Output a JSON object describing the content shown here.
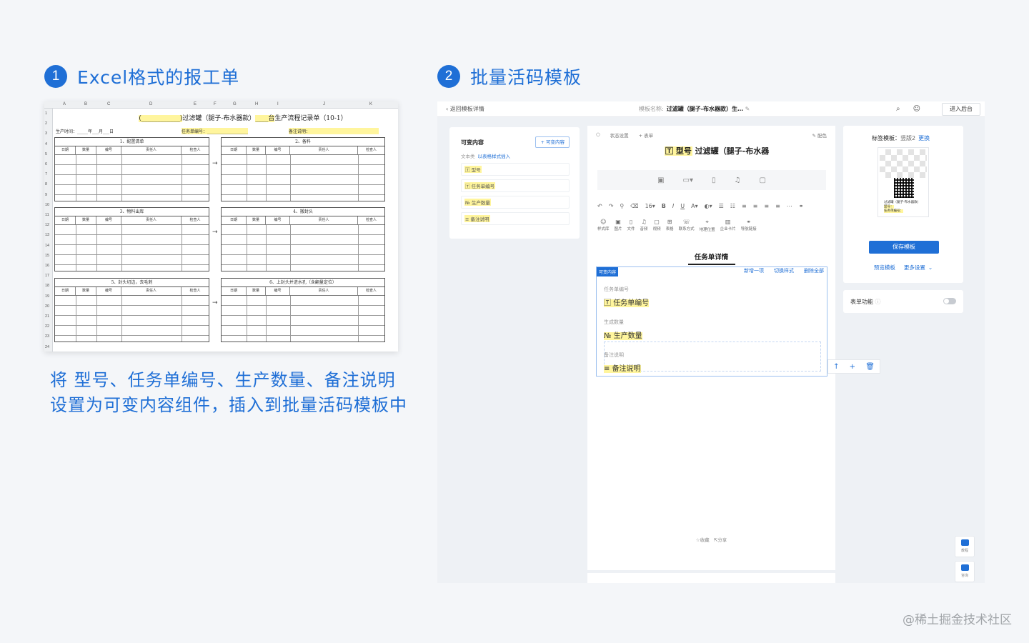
{
  "section1": {
    "number": "1",
    "title": "Excel格式的报工单"
  },
  "section2": {
    "number": "2",
    "title": "批量活码模板"
  },
  "description": {
    "line1": "将 型号、任务单编号、生产数量、备注说明",
    "line2": "设置为可变内容组件，插入到批量活码模板中"
  },
  "watermark": "@稀土掘金技术社区",
  "spreadsheet": {
    "columns": [
      "A",
      "B",
      "C",
      "D",
      "E",
      "F",
      "G",
      "H",
      "I",
      "J",
      "K"
    ],
    "rows": [
      "1",
      "2",
      "3",
      "4",
      "5",
      "6",
      "7",
      "8",
      "9",
      "10",
      "11",
      "12",
      "13",
      "14",
      "15",
      "16",
      "17",
      "18",
      "19",
      "20",
      "21",
      "22",
      "23",
      "24"
    ],
    "title_blank": "(____________)",
    "title_mid": "过滤罐（腿子-布水器款）",
    "title_blank2": "____台",
    "title_end": "生产流程记录单（10-1）",
    "production_time": "生产时间：_____年___月___日",
    "task_no": "任务单编号：___________________",
    "remark": "备注说明：",
    "blocks": [
      {
        "caption": "1、配置清单"
      },
      {
        "caption": "2、备料"
      },
      {
        "caption": "3、物料出库"
      },
      {
        "caption": "4、搬封头"
      },
      {
        "caption": "5、封头切边，去毛刺"
      },
      {
        "caption": "6、上封头并进水孔（含翻量定位）"
      }
    ],
    "col_headers": [
      "日期",
      "数量",
      "编号",
      "责任人",
      "检查人"
    ],
    "arrow": "→"
  },
  "app": {
    "back": "返回模板详情",
    "template_label": "模板名称:",
    "template_name": "过滤罐（腿子-布水器款）生…",
    "enter_backend": "进入后台",
    "variables": {
      "title": "可变内容",
      "add": "+ 可变内容",
      "sub": "文本类",
      "sub_link": "以表格样式插入",
      "items": [
        "型号",
        "任务单编号",
        "生产数量",
        "备注说明"
      ]
    },
    "editor": {
      "status_settings": "状态设置",
      "add_form": "+ 表单",
      "color": "配色",
      "name_chip": "型号",
      "name": "过滤罐（腿子-布水器",
      "font_size": "16",
      "toolbar2": [
        "样式库",
        "图片",
        "文件",
        "音频",
        "视频",
        "表格",
        "联系方式",
        "地理位置",
        "企业卡片",
        "导航链接"
      ],
      "section_heading": "任务单详情",
      "var_tag": "可变内容",
      "actions": [
        "新增一项",
        "切换样式",
        "删除全部"
      ],
      "fields": [
        {
          "label": "任务单编号",
          "value": "任务单编号"
        },
        {
          "label": "生成数量",
          "value": "生产数量"
        },
        {
          "label": "备注说明",
          "value": "备注说明"
        }
      ],
      "collect": "收藏",
      "share": "分享"
    },
    "right": {
      "label_title": "标签模板：",
      "label_value": "竖版2",
      "change": "更换",
      "preview_lines": [
        "过滤罐（腿子-布水器款）",
        "型号：",
        "任务单编号："
      ],
      "save": "保存模板",
      "preview": "预览模板",
      "more": "更多设置",
      "form_fn": "表单功能"
    },
    "float": [
      "教程",
      "咨询"
    ]
  }
}
